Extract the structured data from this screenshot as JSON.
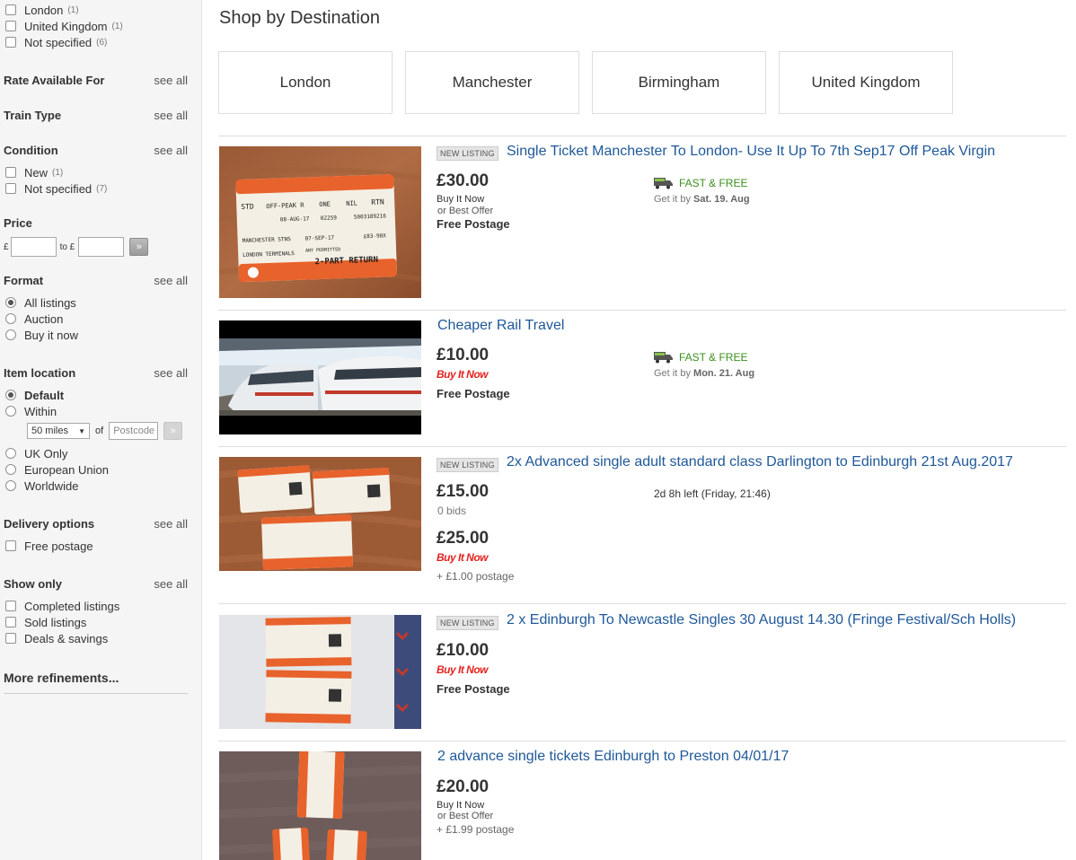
{
  "sidebar": {
    "location_items": [
      {
        "label": "London",
        "count": "(1)"
      },
      {
        "label": "United Kingdom",
        "count": "(1)"
      },
      {
        "label": "Not specified",
        "count": "(6)"
      }
    ],
    "sections": {
      "rate": {
        "title": "Rate Available For",
        "see_all": "see all"
      },
      "train_type": {
        "title": "Train Type",
        "see_all": "see all"
      },
      "condition": {
        "title": "Condition",
        "see_all": "see all"
      },
      "format": {
        "title": "Format",
        "see_all": "see all"
      },
      "item_location": {
        "title": "Item location",
        "see_all": "see all"
      },
      "delivery": {
        "title": "Delivery options",
        "see_all": "see all"
      },
      "show_only": {
        "title": "Show only",
        "see_all": "see all"
      }
    },
    "condition_items": [
      {
        "label": "New",
        "count": "(1)"
      },
      {
        "label": "Not specified",
        "count": "(7)"
      }
    ],
    "price": {
      "title": "Price",
      "from_symbol": "£",
      "to_label": "to £",
      "go": "»"
    },
    "format_items": [
      "All listings",
      "Auction",
      "Buy it now"
    ],
    "location_options": {
      "default": "Default",
      "within": "Within",
      "miles": "50 miles",
      "of": "of",
      "postcode_placeholder": "Postcode",
      "uk_only": "UK Only",
      "eu": "European Union",
      "worldwide": "Worldwide"
    },
    "delivery_items": [
      "Free postage"
    ],
    "show_only_items": [
      "Completed listings",
      "Sold listings",
      "Deals & savings"
    ],
    "more_refinements": "More refinements..."
  },
  "main": {
    "title": "Shop by Destination",
    "destinations": [
      "London",
      "Manchester",
      "Birmingham",
      "United Kingdom"
    ],
    "listings": [
      {
        "tag": "NEW LISTING",
        "title": "Single Ticket Manchester To London- Use It Up To 7th Sep17 Off Peak Virgin",
        "price": "£30.00",
        "line1": "Buy It Now",
        "line2": "or Best Offer",
        "postage": "Free Postage",
        "ship": "FAST & FREE",
        "getit_prefix": "Get it by",
        "getit_date": "Sat. 19. Aug"
      },
      {
        "title": "Cheaper Rail Travel",
        "price": "£10.00",
        "bin": "Buy It Now",
        "postage": "Free Postage",
        "ship": "FAST & FREE",
        "getit_prefix": "Get it by",
        "getit_date": "Mon. 21. Aug"
      },
      {
        "tag": "NEW LISTING",
        "title": "2x Advanced single adult standard class Darlington to Edinburgh 21st Aug.2017",
        "price": "£15.00",
        "bids": "0 bids",
        "price2": "£25.00",
        "bin": "Buy It Now",
        "postage": "+ £1.00 postage",
        "time_left": "2d 8h left (Friday, 21:46)"
      },
      {
        "tag": "NEW LISTING",
        "title": "2 x Edinburgh To Newcastle Singles 30 August 14.30 (Fringe Festival/Sch Holls)",
        "price": "£10.00",
        "bin": "Buy It Now",
        "postage": "Free Postage"
      },
      {
        "title": "2 advance single tickets Edinburgh to Preston 04/01/17",
        "price": "£20.00",
        "line1": "Buy It Now",
        "line2": "or Best Offer",
        "postage": "+ £1.99 postage"
      }
    ],
    "ticket_text": {
      "class": "STD",
      "type": "OFF-PEAK R",
      "adult": "ONE",
      "child": "NIL",
      "rtn": "RTN",
      "date": "08-AUG-17",
      "number": "02259",
      "ref": "5003189216",
      "from": "MANCHESTER STNS",
      "valid": "07-SEP-17",
      "price": "£83-90X",
      "to": "LONDON TERMINALS",
      "route": "ANY PERMITTED",
      "mark": "2-PART RETURN"
    }
  }
}
